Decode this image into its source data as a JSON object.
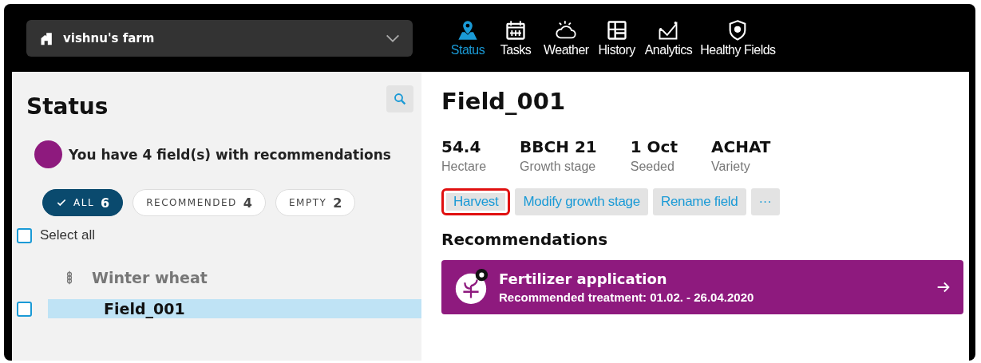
{
  "farm_selector": {
    "label": "vishnu's farm"
  },
  "nav": [
    {
      "label": "Status",
      "selected": true
    },
    {
      "label": "Tasks",
      "selected": false
    },
    {
      "label": "Weather",
      "selected": false
    },
    {
      "label": "History",
      "selected": false
    },
    {
      "label": "Analytics",
      "selected": false
    },
    {
      "label": "Healthy Fields",
      "selected": false
    }
  ],
  "sidebar": {
    "title": "Status",
    "notice": {
      "text": "You have 4 field(s) with recommendations",
      "color": "#8e1a7e"
    },
    "filters": [
      {
        "label": "ALL",
        "count": "6",
        "selected": true
      },
      {
        "label": "RECOMMENDED",
        "count": "4",
        "selected": false
      },
      {
        "label": "EMPTY",
        "count": "2",
        "selected": false
      }
    ],
    "select_all": {
      "label": "Select all",
      "checked": false
    },
    "groups": [
      {
        "label": "Winter wheat",
        "children": [
          {
            "label": "Field_001",
            "selected": true,
            "checked": false
          }
        ]
      }
    ]
  },
  "detail": {
    "title": "Field_001",
    "stats": [
      {
        "value": "54.4",
        "label": "Hectare"
      },
      {
        "value": "BBCH 21",
        "label": "Growth stage"
      },
      {
        "value": "1 Oct",
        "label": "Seeded"
      },
      {
        "value": "ACHAT",
        "label": "Variety"
      }
    ],
    "actions": [
      {
        "label": "Harvest",
        "highlighted": true
      },
      {
        "label": "Modify growth stage",
        "highlighted": false
      },
      {
        "label": "Rename field",
        "highlighted": false
      },
      {
        "label": "···",
        "highlighted": false
      }
    ],
    "recommendations_title": "Recommendations",
    "recommendations": [
      {
        "title": "Fertilizer application",
        "subtitle": "Recommended treatment: 01.02. - 26.04.2020",
        "color": "#8e1a7e"
      }
    ]
  }
}
